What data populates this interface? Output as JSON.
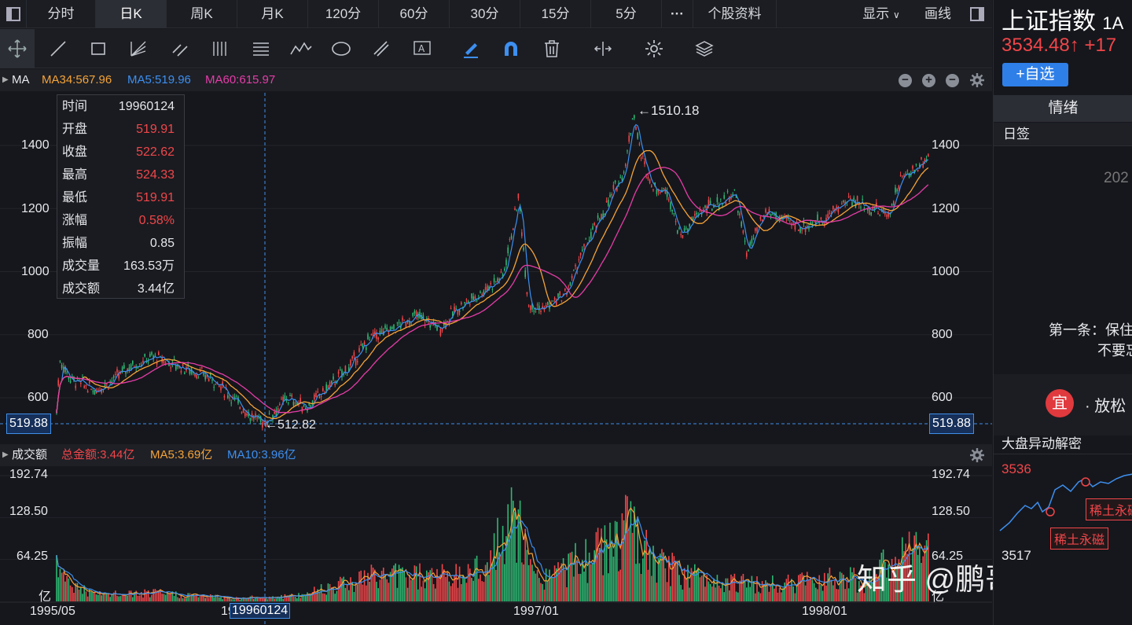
{
  "topbar": {
    "tabs": [
      "分时",
      "日K",
      "周K",
      "月K",
      "120分",
      "60分",
      "30分",
      "15分",
      "5分"
    ],
    "more": "···",
    "stock_info": "个股资料",
    "display": "显示",
    "draw": "画线"
  },
  "ma": {
    "title": "MA",
    "ma34": "MA34:567.96",
    "ma5": "MA5:519.96",
    "ma60": "MA60:615.97"
  },
  "tooltip": {
    "rows": [
      [
        "时间",
        "19960124"
      ],
      [
        "开盘",
        "519.91"
      ],
      [
        "收盘",
        "522.62"
      ],
      [
        "最高",
        "524.33"
      ],
      [
        "最低",
        "519.91"
      ],
      [
        "涨幅",
        "0.58%"
      ],
      [
        "振幅",
        "0.85"
      ],
      [
        "成交量",
        "163.53万"
      ],
      [
        "成交额",
        "3.44亿"
      ]
    ]
  },
  "price_axis": [
    "1400",
    "1200",
    "1000",
    "800",
    "600"
  ],
  "cursor_price": "519.88",
  "high_label": "←1510.18",
  "low_label": "←512.82",
  "volume": {
    "title": "成交额",
    "total": "总金额:3.44亿",
    "ma5": "MA5:3.69亿",
    "ma10": "MA10:3.96亿",
    "axis": [
      "192.74",
      "128.50",
      "64.25",
      "亿"
    ]
  },
  "x_axis": {
    "start": "1995/05",
    "cursor": "19960124",
    "mid": "1997/01",
    "end": "1998/01",
    "left_fragment": "19"
  },
  "side": {
    "title": "上证指数",
    "code": "1A",
    "price": "3534.48↑",
    "change": "+17",
    "add_btn": "+自选",
    "section": "情绪",
    "tag": "日签",
    "year": "202",
    "rule1": "第一条：保住",
    "rule2": "不要忘",
    "avatar_char": "宜",
    "relax": "· 放松",
    "news": "大盘异动解密",
    "p_high": "3536",
    "p_low": "3517",
    "event": "稀土永磁",
    "event2": "稀土永磁"
  },
  "watermark": "知乎 @鹏哥投研",
  "colors": {
    "up": "#f0464a",
    "down": "#2eb872",
    "ma5": "#3d8ff0",
    "ma34": "#f5a338",
    "ma60": "#e63ca8",
    "accent": "#2f7fe8"
  }
}
